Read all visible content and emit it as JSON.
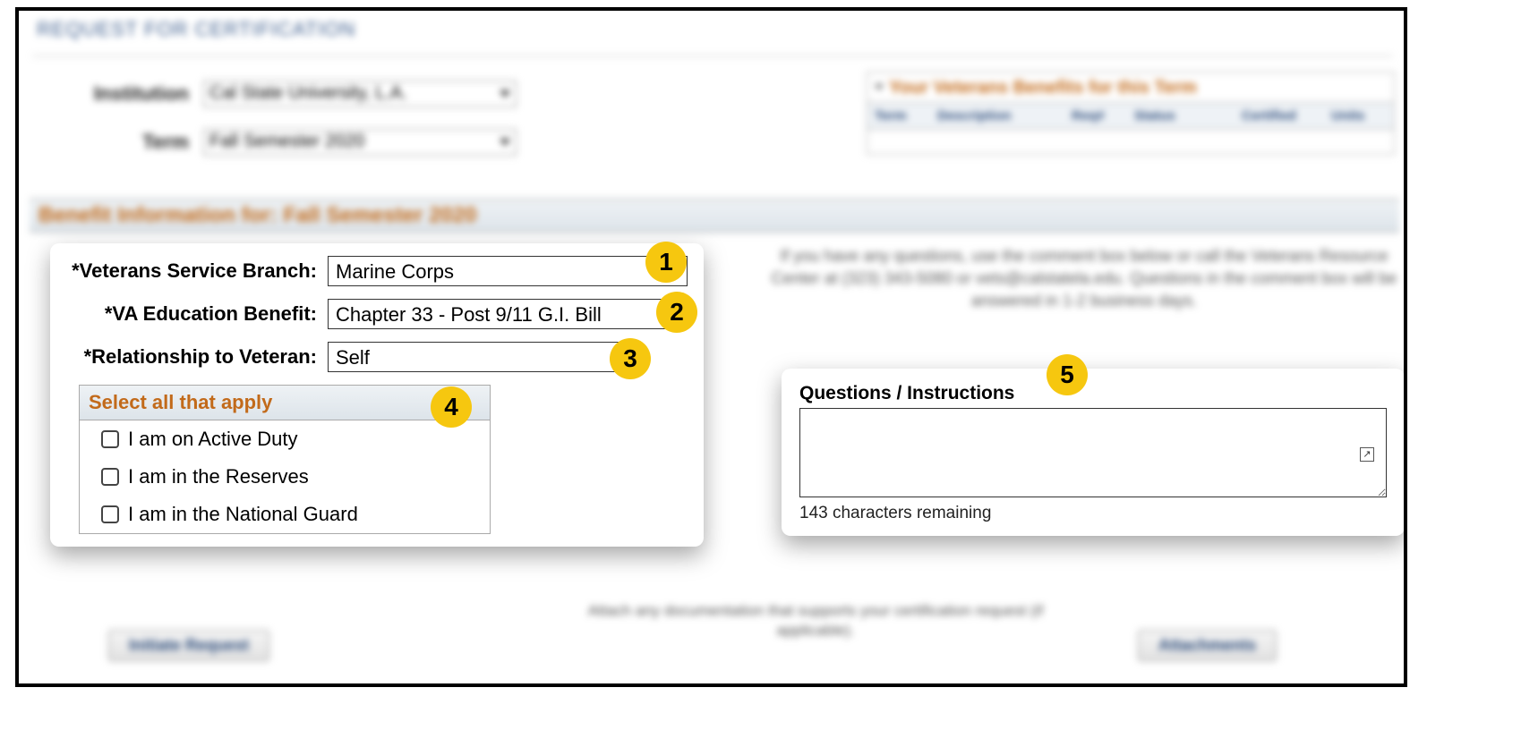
{
  "page": {
    "title": "REQUEST FOR CERTIFICATION"
  },
  "top": {
    "institution_label": "Institution",
    "institution_value": "Cal State University, L.A.",
    "term_label": "Term",
    "term_value": "Fall Semester 2020"
  },
  "benefits_panel": {
    "title": "Your Veterans Benefits for this Term",
    "headers": [
      "Term",
      "Description",
      "Req#",
      "Status",
      "Certified",
      "Units"
    ]
  },
  "section_title": "Benefit Information for: Fall Semester 2020",
  "help_text": "If you have any questions, use the comment box below or call the Veterans Resource Center at (323) 343-5080 or vets@calstatela.edu. Questions in the comment box will be answered in 1-2 business days.",
  "form": {
    "branch_label": "*Veterans Service Branch:",
    "branch_value": "Marine Corps",
    "benefit_label": "*VA Education Benefit:",
    "benefit_value": "Chapter 33 - Post 9/11 G.I. Bill",
    "relationship_label": "*Relationship to Veteran:",
    "relationship_value": "Self",
    "apply_title": "Select all that apply",
    "options": [
      "I am on Active Duty",
      "I am in the Reserves",
      "I am in the National Guard"
    ]
  },
  "questions": {
    "label": "Questions / Instructions",
    "remaining": "143 characters remaining"
  },
  "attach_text": "Attach any documentation that supports your certification request (if applicable).",
  "buttons": {
    "initiate": "Initiate Request",
    "attachments": "Attachments"
  },
  "badges": [
    "1",
    "2",
    "3",
    "4",
    "5"
  ]
}
